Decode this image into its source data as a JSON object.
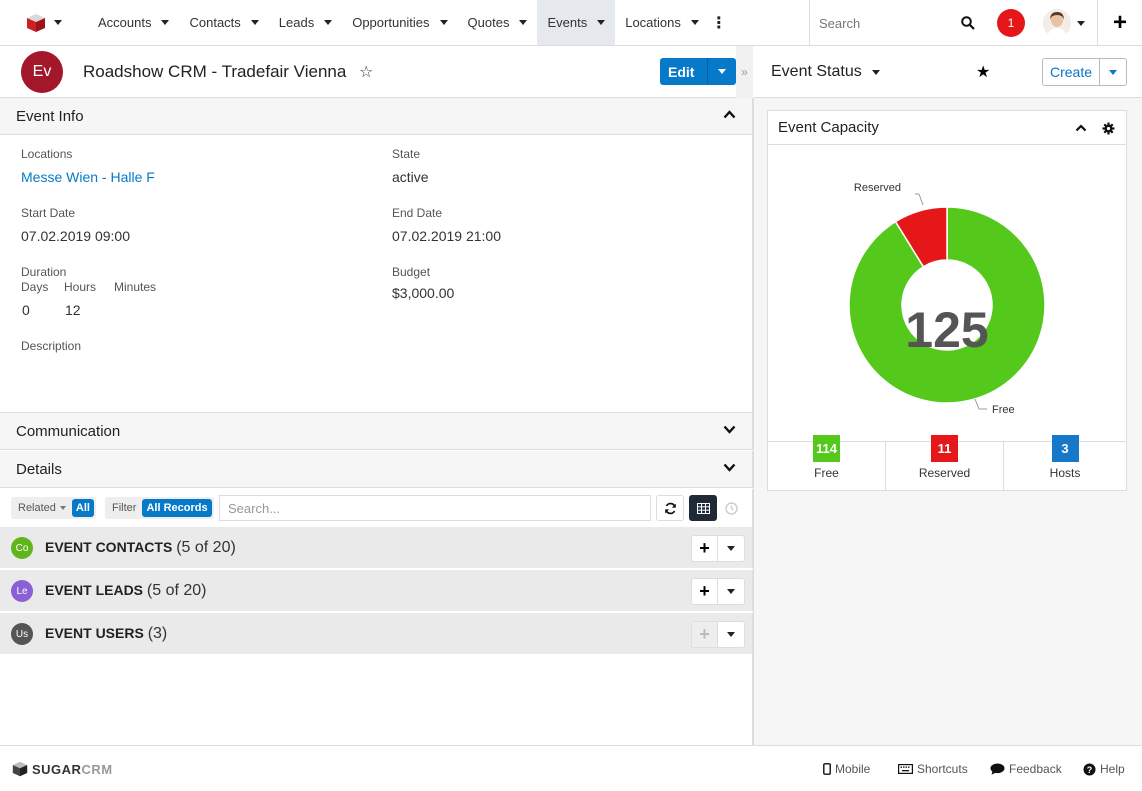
{
  "nav": {
    "items": [
      "Accounts",
      "Contacts",
      "Leads",
      "Opportunities",
      "Quotes",
      "Events",
      "Locations"
    ],
    "active": "Events",
    "search_placeholder": "Search",
    "notification_count": "1"
  },
  "record": {
    "avatar_initials": "Ev",
    "title": "Roadshow CRM - Tradefair Vienna",
    "edit_label": "Edit"
  },
  "panels": {
    "event_info": "Event Info",
    "communication": "Communication",
    "details": "Details"
  },
  "fields": {
    "locations_label": "Locations",
    "locations_value": "Messe Wien - Halle F",
    "state_label": "State",
    "state_value": "active",
    "start_label": "Start Date",
    "start_value": "07.02.2019 09:00",
    "end_label": "End Date",
    "end_value": "07.02.2019 21:00",
    "duration_label": "Duration",
    "days_label": "Days",
    "hours_label": "Hours",
    "minutes_label": "Minutes",
    "days_value": "0",
    "hours_value": "12",
    "budget_label": "Budget",
    "budget_value": "$3,000.00",
    "description_label": "Description"
  },
  "subpanel_toolbar": {
    "related_label": "Related",
    "related_value": "All",
    "filter_label": "Filter",
    "filter_value": "All Records",
    "search_placeholder": "Search..."
  },
  "subpanels": [
    {
      "initials": "Co",
      "color": "#5fb61c",
      "title": "EVENT CONTACTS",
      "count": "(5 of 20)"
    },
    {
      "initials": "Le",
      "color": "#8b5fd6",
      "title": "EVENT LEADS",
      "count": "(5 of 20)"
    },
    {
      "initials": "Us",
      "color": "#555555",
      "title": "EVENT USERS",
      "count": "(3)"
    }
  ],
  "side": {
    "title": "Event Status",
    "create_label": "Create",
    "dashlet_title": "Event Capacity",
    "center_value": "125",
    "chart_labels": {
      "reserved": "Reserved",
      "free": "Free"
    },
    "stats": [
      {
        "value": "114",
        "label": "Free",
        "color": "#55c81c"
      },
      {
        "value": "11",
        "label": "Reserved",
        "color": "#e61718"
      },
      {
        "value": "3",
        "label": "Hosts",
        "color": "#1678c8"
      }
    ]
  },
  "chart_data": {
    "type": "pie",
    "categories": [
      "Free",
      "Reserved"
    ],
    "values": [
      114,
      11
    ],
    "colors": [
      "#55c81c",
      "#e61718"
    ],
    "center_label": "125"
  },
  "footer": {
    "logo_text_a": "SUGAR",
    "logo_text_b": "CRM",
    "links": [
      "Mobile",
      "Shortcuts",
      "Feedback",
      "Help"
    ]
  }
}
